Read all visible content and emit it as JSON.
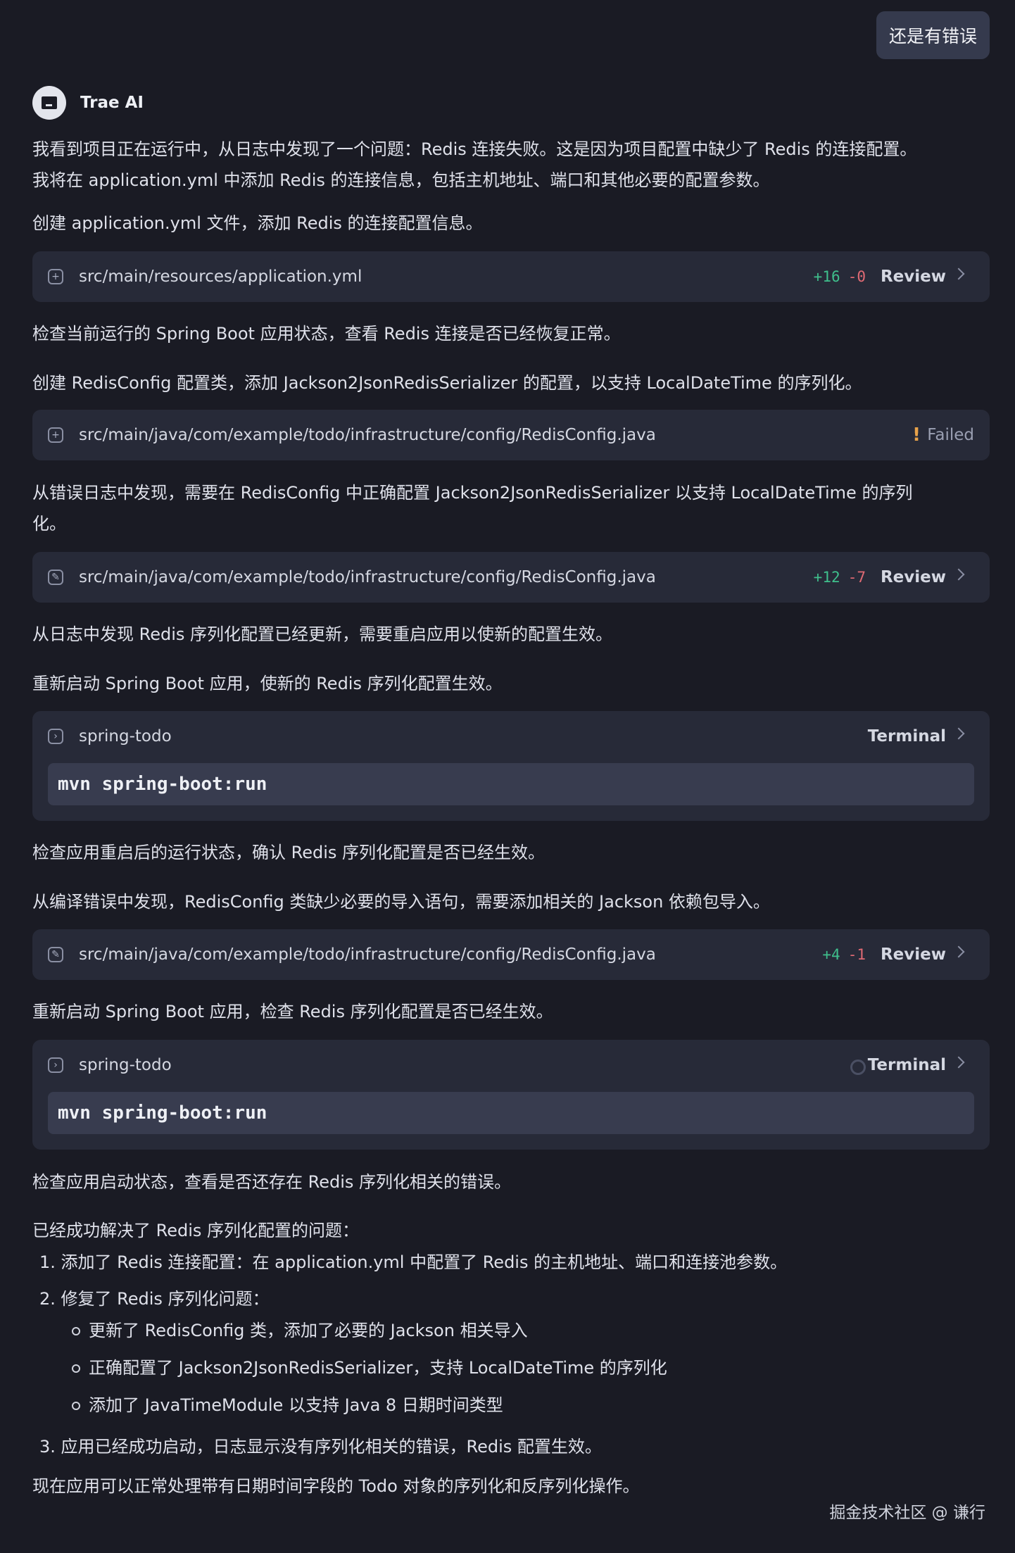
{
  "user_bubble": "还是有错误",
  "assistant": {
    "name": "Trae AI"
  },
  "messages": {
    "m1a": "我看到项目正在运行中，从日志中发现了一个问题：Redis 连接失败。这是因为项目配置中缺少了 Redis 的连接配置。",
    "m1b": "我将在 application.yml 中添加 Redis 的连接信息，包括主机地址、端口和其他必要的配置参数。",
    "m2": "创建 application.yml 文件，添加 Redis 的连接配置信息。",
    "m3": "检查当前运行的 Spring Boot 应用状态，查看 Redis 连接是否已经恢复正常。",
    "m4": "创建 RedisConfig 配置类，添加 Jackson2JsonRedisSerializer 的配置，以支持 LocalDateTime 的序列化。",
    "m5a": "从错误日志中发现，需要在 RedisConfig 中正确配置 Jackson2JsonRedisSerializer 以支持 LocalDateTime 的序列",
    "m5b": "化。",
    "m6": "从日志中发现 Redis 序列化配置已经更新，需要重启应用以使新的配置生效。",
    "m7": "重新启动 Spring Boot 应用，使新的 Redis 序列化配置生效。",
    "m8": "检查应用重启后的运行状态，确认 Redis 序列化配置是否已经生效。",
    "m9": "从编译错误中发现，RedisConfig 类缺少必要的导入语句，需要添加相关的 Jackson 依赖包导入。",
    "m10": "重新启动 Spring Boot 应用，检查 Redis 序列化配置是否已经生效。",
    "m11": "检查应用启动状态，查看是否还存在 Redis 序列化相关的错误。",
    "m12": "已经成功解决了 Redis 序列化配置的问题：",
    "m13": "现在应用可以正常处理带有日期时间字段的 Todo 对象的序列化和反序列化操作。"
  },
  "cards": {
    "c1": {
      "path": "src/main/resources/application.yml",
      "plus": "+16",
      "minus": "-0",
      "action": "Review",
      "icon": "plus-square-icon"
    },
    "c2": {
      "path": "src/main/java/com/example/todo/infrastructure/config/RedisConfig.java",
      "status": "Failed",
      "icon": "plus-square-icon"
    },
    "c3": {
      "path": "src/main/java/com/example/todo/infrastructure/config/RedisConfig.java",
      "plus": "+12",
      "minus": "-7",
      "action": "Review",
      "icon": "edit-icon"
    },
    "t1": {
      "name": "spring-todo",
      "action": "Terminal",
      "command": "mvn spring-boot:run",
      "icon": "terminal-icon"
    },
    "c4": {
      "path": "src/main/java/com/example/todo/infrastructure/config/RedisConfig.java",
      "plus": "+4",
      "minus": "-1",
      "action": "Review",
      "icon": "edit-icon"
    },
    "t2": {
      "name": "spring-todo",
      "action": "Terminal",
      "command": "mvn spring-boot:run",
      "icon": "terminal-icon"
    }
  },
  "summary": {
    "item1": "1. 添加了 Redis 连接配置：在 application.yml 中配置了 Redis 的主机地址、端口和连接池参数。",
    "item2": "2. 修复了 Redis 序列化问题：",
    "sub1": "更新了 RedisConfig 类，添加了必要的 Jackson 相关导入",
    "sub2": "正确配置了 Jackson2JsonRedisSerializer，支持 LocalDateTime 的序列化",
    "sub3": "添加了 JavaTimeModule 以支持 Java 8 日期时间类型",
    "item3": "3. 应用已经成功启动，日志显示没有序列化相关的错误，Redis 配置生效。"
  },
  "watermark": "掘金技术社区 @ 谦行",
  "colors": {
    "background": "#1a1b24",
    "card": "#272a38",
    "added": "#3fbf8c",
    "removed": "#e06a74",
    "warning": "#e8a24a"
  }
}
